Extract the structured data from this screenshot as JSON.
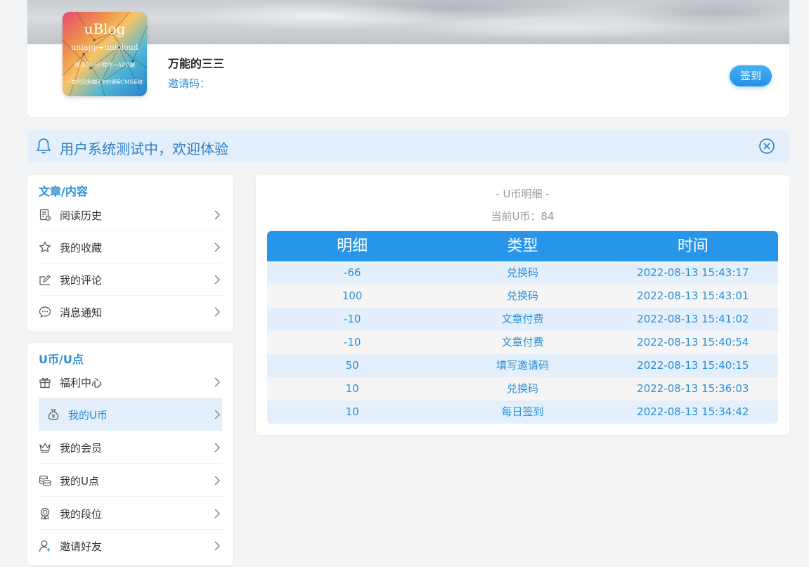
{
  "profile": {
    "avatar": {
      "title": "uBlog",
      "subtitle": "uniapp+unicloud",
      "tagline": "阿贝尔→小程序→APP端",
      "footer": "一套代码多端同步的博客CMS系统"
    },
    "name": "万能的三三",
    "invite_label": "邀请码：",
    "signin_label": "签到"
  },
  "notice": {
    "text": "用户系统测试中，欢迎体验",
    "icon": "bell-icon",
    "close_icon": "close-circle-icon"
  },
  "sections": [
    {
      "title": "文章/内容",
      "items": [
        {
          "label": "阅读历史",
          "icon": "history-doc-icon"
        },
        {
          "label": "我的收藏",
          "icon": "star-icon"
        },
        {
          "label": "我的评论",
          "icon": "edit-icon"
        },
        {
          "label": "消息通知",
          "icon": "message-icon"
        }
      ]
    },
    {
      "title": "U币/U点",
      "items": [
        {
          "label": "福利中心",
          "icon": "gift-icon"
        },
        {
          "label": "我的U币",
          "icon": "coin-bag-icon",
          "active": true
        },
        {
          "label": "我的会员",
          "icon": "crown-icon"
        },
        {
          "label": "我的U点",
          "icon": "coins-stack-icon"
        },
        {
          "label": "我的段位",
          "icon": "badge-icon"
        },
        {
          "label": "邀请好友",
          "icon": "add-user-icon"
        }
      ]
    }
  ],
  "ledger": {
    "title": "- U币明细 -",
    "balance_text": "当前U币：84",
    "columns": [
      "明细",
      "类型",
      "时间"
    ],
    "rows": [
      [
        "-66",
        "兑换码",
        "2022-08-13 15:43:17"
      ],
      [
        "100",
        "兑换码",
        "2022-08-13 15:43:01"
      ],
      [
        "-10",
        "文章付费",
        "2022-08-13 15:41:02"
      ],
      [
        "-10",
        "文章付费",
        "2022-08-13 15:40:54"
      ],
      [
        "50",
        "填写邀请码",
        "2022-08-13 15:40:15"
      ],
      [
        "10",
        "兑换码",
        "2022-08-13 15:36:03"
      ],
      [
        "10",
        "每日签到",
        "2022-08-13 15:34:42"
      ]
    ]
  },
  "colors": {
    "accent": "#2796ea",
    "text_accent": "#2a8fd8",
    "notice_bg": "#e3f0fb",
    "page_bg": "#f3f4f6"
  }
}
